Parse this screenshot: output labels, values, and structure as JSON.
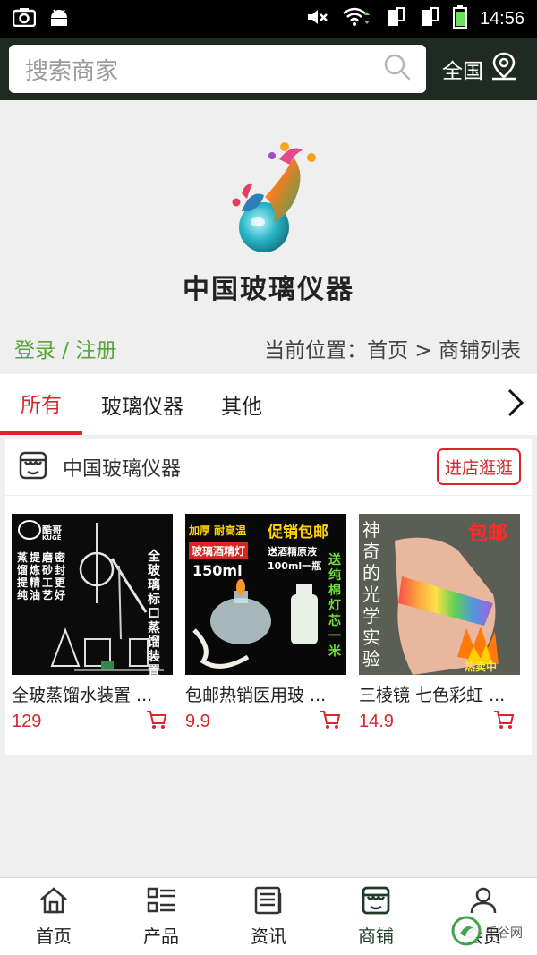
{
  "status": {
    "time": "14:56"
  },
  "search": {
    "placeholder": "搜索商家",
    "region": "全国"
  },
  "banner": {
    "brand": "中国玻璃仪器"
  },
  "crumbs": {
    "login": "登录 / 注册",
    "location": "当前位置：首页 > 商铺列表"
  },
  "tabs": [
    {
      "label": "所有",
      "active": true
    },
    {
      "label": "玻璃仪器",
      "active": false
    },
    {
      "label": "其他",
      "active": false
    }
  ],
  "shop": {
    "name": "中国玻璃仪器",
    "visit_label": "进店逛逛",
    "products": [
      {
        "title": "全玻蒸馏水装置 ...",
        "price": "129",
        "image_text": {
          "brand": "酷哥",
          "brand_en": "KUGE",
          "cols": [
            "全玻璃标口蒸馏装置",
            "蒸馏提纯",
            "提炼精油",
            "磨砂工艺",
            "密封更好"
          ]
        }
      },
      {
        "title": "包邮热销医用玻 ...",
        "price": "9.9",
        "image_text": {
          "top": "加厚 耐高温",
          "promo": "促销包邮",
          "lamp": "玻璃酒精灯",
          "liquid": "送酒精原液",
          "volume": "150ml",
          "bottle": "100ml一瓶",
          "wick": "送纯棉灯芯一米"
        }
      },
      {
        "title": "三棱镜 七色彩虹 ...",
        "price": "14.9",
        "image_text": {
          "free": "包邮",
          "side": "神奇的光学实验",
          "hot": "热卖中"
        }
      }
    ]
  },
  "nav": [
    {
      "label": "首页",
      "icon": "home-icon",
      "active": false
    },
    {
      "label": "产品",
      "icon": "list-icon",
      "active": false
    },
    {
      "label": "资讯",
      "icon": "news-icon",
      "active": false
    },
    {
      "label": "商铺",
      "icon": "store-icon",
      "active": true
    },
    {
      "label": "会员",
      "icon": "user-icon",
      "active": false
    }
  ],
  "watermark": {
    "text": "乐谷网"
  }
}
